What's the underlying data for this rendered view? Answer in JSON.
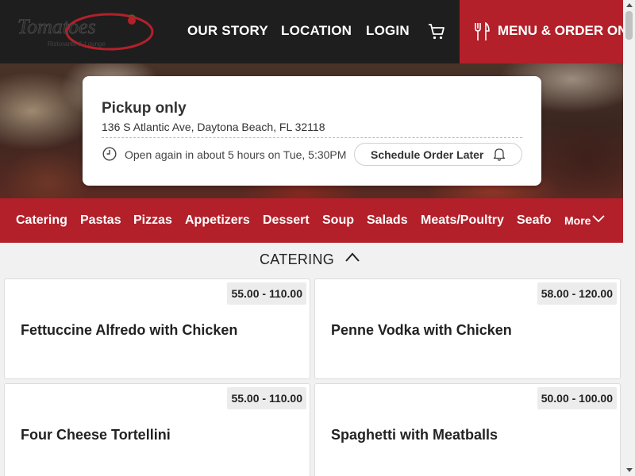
{
  "header": {
    "logo_alt": "Restaurant logo",
    "nav": [
      "OUR STORY",
      "LOCATION",
      "LOGIN"
    ],
    "menu_order_label": "MENU & ORDER ONLINE",
    "brand_red": "#b3202a",
    "header_bg": "#1e1e1e"
  },
  "pickup": {
    "title": "Pickup only",
    "address": "136 S Atlantic Ave, Daytona Beach, FL 32118",
    "open_status": "Open again in about 5 hours on Tue, 5:30PM",
    "schedule_label": "Schedule Order Later"
  },
  "categories": {
    "items": [
      "Catering",
      "Pastas",
      "Pizzas",
      "Appetizers",
      "Dessert",
      "Soup",
      "Salads",
      "Meats/Poultry",
      "Seafood"
    ],
    "more_label": "More"
  },
  "section": {
    "title": "CATERING"
  },
  "menu_items": [
    {
      "name": "Fettuccine Alfredo with Chicken",
      "price": "55.00 - 110.00"
    },
    {
      "name": "Penne Vodka with Chicken",
      "price": "58.00 - 120.00"
    },
    {
      "name": "Four Cheese Tortellini",
      "price": "55.00 - 110.00"
    },
    {
      "name": "Spaghetti with Meatballs",
      "price": "50.00 - 100.00"
    }
  ],
  "icons": {
    "cart": "cart-icon",
    "menu": "fork-knife-icon",
    "clock": "clock-icon",
    "bell": "bell-icon",
    "more": "chevron-down-icon",
    "collapse": "chevron-up-icon"
  }
}
